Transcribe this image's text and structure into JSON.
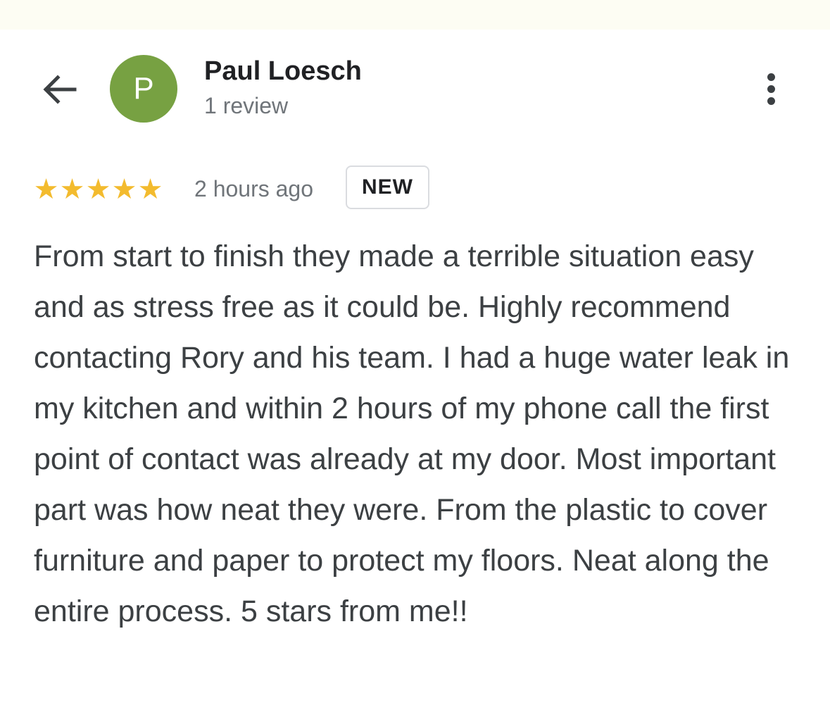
{
  "header": {
    "back_icon": "arrow-back-icon",
    "avatar_letter": "P",
    "avatar_color": "#77a142",
    "author_name": "Paul Loesch",
    "review_count": "1 review",
    "more_icon": "more-vertical-icon"
  },
  "review": {
    "rating": 5,
    "max_rating": 5,
    "star_color": "#f3bb2e",
    "time_ago": "2 hours ago",
    "badge": "NEW",
    "text": "From start to finish they made a terrible situation easy and as stress free as it could be. Highly recommend contacting Rory and his team. I had a huge water leak in my kitchen and within 2 hours of my phone call the first point of contact was already at my door. Most important part was how neat they were. From the plastic to cover furniture and paper to protect my floors. Neat along the entire process. 5 stars from me!!"
  }
}
